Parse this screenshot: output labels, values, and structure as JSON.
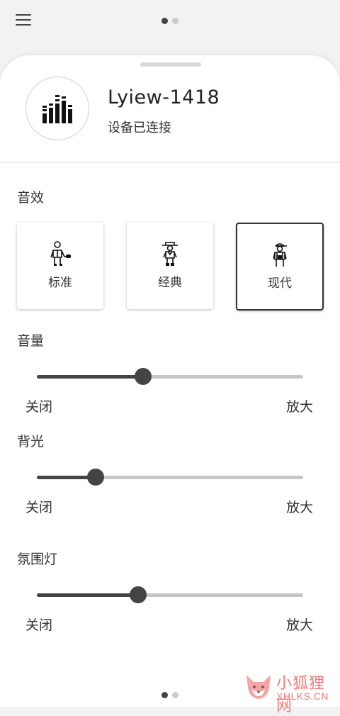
{
  "pager": {
    "pages": 2,
    "active": 0
  },
  "header": {
    "menu_icon": "hamburger-menu-icon"
  },
  "device": {
    "icon": "equalizer-icon",
    "name": "Lyiew-1418",
    "status": "设备已连接"
  },
  "sound_effect": {
    "title": "音效",
    "presets": [
      {
        "label": "标准",
        "icon": "singer-with-microphone-icon",
        "selected": false
      },
      {
        "label": "经典",
        "icon": "cowboy-icon",
        "selected": false
      },
      {
        "label": "现代",
        "icon": "worker-with-cap-icon",
        "selected": true
      }
    ]
  },
  "volume": {
    "title": "音量",
    "value": 0.4,
    "min_label": "关闭",
    "max_label": "放大"
  },
  "backlight": {
    "title": "背光",
    "value": 0.22,
    "min_label": "关闭",
    "max_label": "放大"
  },
  "ambient_light": {
    "title": "氛围灯",
    "value": 0.38,
    "min_label": "关闭",
    "max_label": "放大"
  },
  "colors": {
    "accent": "#444444",
    "track": "#c6c6c6",
    "background": "#f2f2f2",
    "watermark": "#f07d7d"
  },
  "watermark": {
    "title": "小狐狸网",
    "subtitle": "XHLKS.CN"
  }
}
